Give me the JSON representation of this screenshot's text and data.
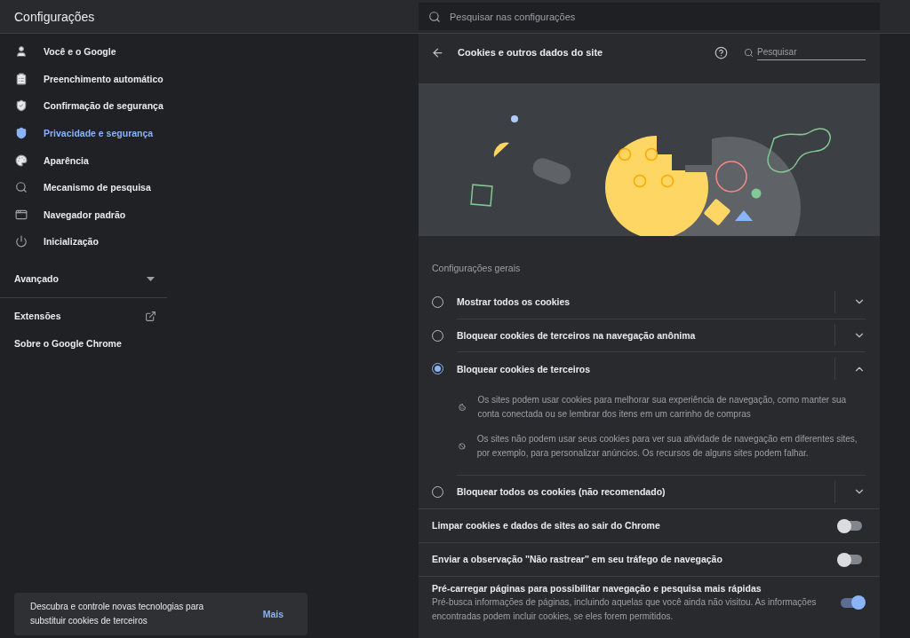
{
  "header": {
    "title": "Configurações",
    "search": {
      "placeholder": "Pesquisar nas configurações"
    }
  },
  "sidebar": {
    "items": [
      {
        "label": "Você e o Google",
        "selected": false
      },
      {
        "label": "Preenchimento automático",
        "selected": false
      },
      {
        "label": "Confirmação de segurança",
        "selected": false
      },
      {
        "label": "Privacidade e segurança",
        "selected": true
      },
      {
        "label": "Aparência",
        "selected": false
      },
      {
        "label": "Mecanismo de pesquisa",
        "selected": false
      },
      {
        "label": "Navegador padrão",
        "selected": false
      },
      {
        "label": "Inicialização",
        "selected": false
      }
    ],
    "advanced": {
      "label": "Avançado",
      "expanded": false
    },
    "links": [
      {
        "label": "Extensões",
        "kind": "external"
      },
      {
        "label": "Sobre o Google Chrome",
        "kind": "plain"
      }
    ],
    "promo": {
      "text": "Descubra e controle novas tecnologias para substituir cookies de terceiros",
      "link": "Mais"
    }
  },
  "panel": {
    "title": "Cookies e outros dados do site",
    "search": {
      "placeholder": "Pesquisar"
    },
    "section_title": "Configurações gerais",
    "options": [
      {
        "label": "Mostrar todos os cookies",
        "selected": false,
        "expanded": false
      },
      {
        "label": "Bloquear cookies de terceiros na navegação anônima",
        "selected": false,
        "expanded": false
      },
      {
        "label": "Bloquear cookies de terceiros",
        "selected": true,
        "expanded": true,
        "details": [
          {
            "kind": "cookie",
            "text": "Os sites podem usar cookies para melhorar sua experiência de navegação, como manter sua conta conectada ou se lembrar dos itens em um carrinho de compras"
          },
          {
            "kind": "block",
            "text": "Os sites não podem usar seus cookies para ver sua atividade de navegação em diferentes sites, por exemplo, para personalizar anúncios. Os recursos de alguns sites podem falhar."
          }
        ]
      },
      {
        "label": "Bloquear todos os cookies (não recomendado)",
        "selected": false,
        "expanded": false
      }
    ],
    "toggles": [
      {
        "label": "Limpar cookies e dados de sites ao sair do Chrome",
        "on": false
      },
      {
        "label": "Enviar a observação \"Não rastrear\" em seu tráfego de navegação",
        "on": false
      },
      {
        "label": "Pré-carregar páginas para possibilitar navegação e pesquisa mais rápidas",
        "description": "Pré-busca informações de páginas, incluindo aquelas que você ainda não visitou. As informações encontradas podem incluir cookies, se eles forem permitidos.",
        "on": true
      }
    ]
  }
}
